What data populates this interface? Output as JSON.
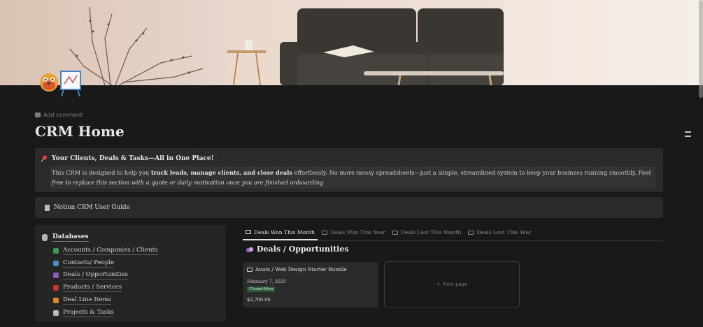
{
  "header": {
    "add_comment": "Add comment",
    "title": "CRM Home"
  },
  "callout": {
    "icon": "pushpin-icon",
    "title": "Your Clients, Deals & Tasks—All in One Place!",
    "body_1": "This CRM is designed to help you ",
    "body_bold_1": "track leads, manage clients, and close deals",
    "body_2": " effortlessly. No more messy spreadsheets—just a simple, streamlined system to keep your business running smoothly. ",
    "body_italic": "Feel free to replace this section with a quote or daily motivation once you are finished onboarding"
  },
  "guide": {
    "icon": "document-icon",
    "label": "Notion CRM User Guide"
  },
  "databases": {
    "title": "Databases",
    "items": [
      {
        "label": "Accounts / Companies / Clients",
        "color": "#3f9a5a"
      },
      {
        "label": "Contacts/ People",
        "color": "#4a8fc2"
      },
      {
        "label": "Deals / Opportunities",
        "color": "#8c59b8"
      },
      {
        "label": "Products / Services",
        "color": "#c0392b"
      },
      {
        "label": "Deal Line Items",
        "color": "#d68a2e"
      },
      {
        "label": "Projects & Tasks",
        "color": "#b9b9b9"
      }
    ]
  },
  "tabs": [
    {
      "label": "Deals Won This Month",
      "active": true
    },
    {
      "label": "Deals Won This Year",
      "active": false
    },
    {
      "label": "Deals Lost This Month",
      "active": false
    },
    {
      "label": "Deals Lost This Year",
      "active": false
    }
  ],
  "deals": {
    "title": "Deals / Opportunities",
    "card": {
      "title": "Anoix / Web Design Starter Bundle",
      "date": "February 7, 2025",
      "status": "Closed-Won",
      "amount": "$2,700.00"
    },
    "new_page": "New page"
  },
  "colors": {
    "background": "#191919",
    "panel": "#2a2a2a",
    "badge_green": "#2c5a3b"
  }
}
